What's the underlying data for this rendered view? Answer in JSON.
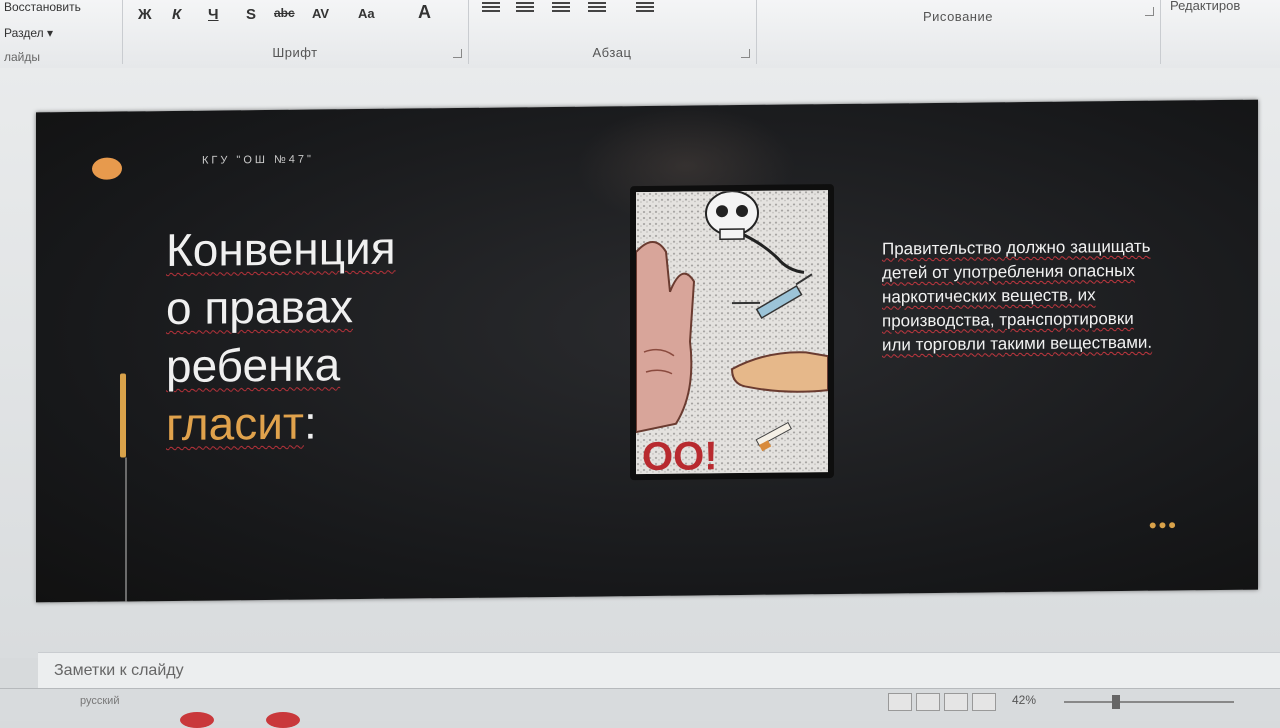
{
  "ribbon": {
    "restore_label": "Восстановить",
    "section_label": "Раздел",
    "slides_label": "лайды",
    "font_group": "Шрифт",
    "paragraph_group": "Абзац",
    "drawing_group": "Рисование",
    "editing_group": "Редактиров",
    "font_buttons": [
      "Ж",
      "К",
      "Ч",
      "S",
      "abc",
      "AV",
      "Aa",
      "A"
    ]
  },
  "slide": {
    "org": "КГУ \"ОШ №47\"",
    "title_lines": [
      "Конвенция",
      "о правах",
      "ребенка"
    ],
    "title_accent": "гласит",
    "title_colon": ":",
    "body_text": "Правительство должно защищать детей от употребления опасных наркотических веществ, их производства, транспортировки или торговли такими веществами.",
    "poster_text": "OO!",
    "dots": "•••"
  },
  "notes": {
    "placeholder": "Заметки к слайду"
  },
  "status": {
    "language": "русский",
    "zoom": "42%"
  },
  "colors": {
    "accent": "#e0a24c",
    "slide_bg": "#17181a",
    "spell_underline": "#c2373f"
  }
}
